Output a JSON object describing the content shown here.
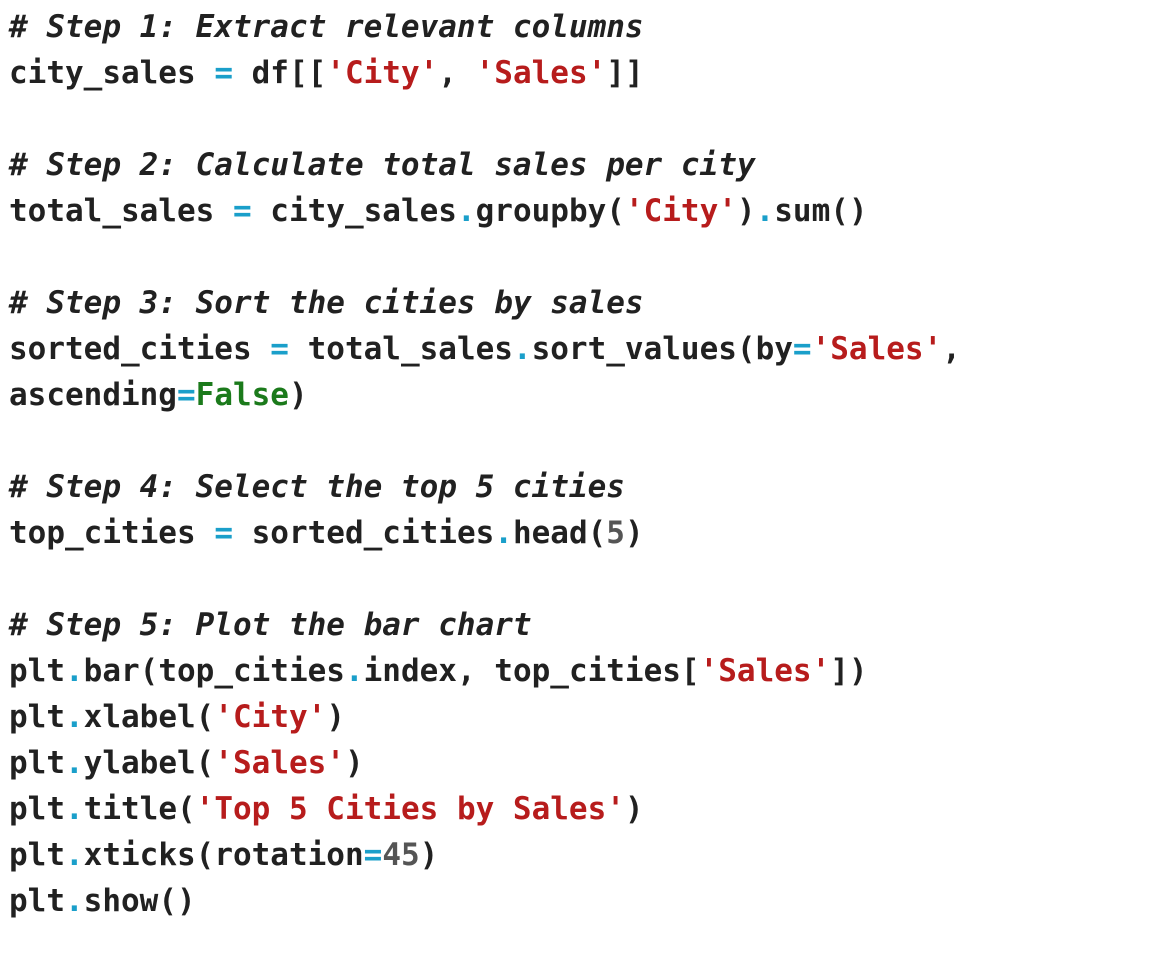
{
  "code": {
    "lines": [
      [
        {
          "t": "comment",
          "v": "# Step 1: Extract relevant columns"
        }
      ],
      [
        {
          "t": "text",
          "v": "city_sales "
        },
        {
          "t": "op",
          "v": "="
        },
        {
          "t": "text",
          "v": " df[["
        },
        {
          "t": "str",
          "v": "'City'"
        },
        {
          "t": "text",
          "v": ", "
        },
        {
          "t": "str",
          "v": "'Sales'"
        },
        {
          "t": "text",
          "v": "]]"
        }
      ],
      [],
      [
        {
          "t": "comment",
          "v": "# Step 2: Calculate total sales per city"
        }
      ],
      [
        {
          "t": "text",
          "v": "total_sales "
        },
        {
          "t": "op",
          "v": "="
        },
        {
          "t": "text",
          "v": " city_sales"
        },
        {
          "t": "op",
          "v": "."
        },
        {
          "t": "text",
          "v": "groupby("
        },
        {
          "t": "str",
          "v": "'City'"
        },
        {
          "t": "text",
          "v": ")"
        },
        {
          "t": "op",
          "v": "."
        },
        {
          "t": "text",
          "v": "sum()"
        }
      ],
      [],
      [
        {
          "t": "comment",
          "v": "# Step 3: Sort the cities by sales"
        }
      ],
      [
        {
          "t": "text",
          "v": "sorted_cities "
        },
        {
          "t": "op",
          "v": "="
        },
        {
          "t": "text",
          "v": " total_sales"
        },
        {
          "t": "op",
          "v": "."
        },
        {
          "t": "text",
          "v": "sort_values(by"
        },
        {
          "t": "op",
          "v": "="
        },
        {
          "t": "str",
          "v": "'Sales'"
        },
        {
          "t": "text",
          "v": ","
        }
      ],
      [
        {
          "t": "text",
          "v": "ascending"
        },
        {
          "t": "op",
          "v": "="
        },
        {
          "t": "kw",
          "v": "False"
        },
        {
          "t": "text",
          "v": ")"
        }
      ],
      [],
      [
        {
          "t": "comment",
          "v": "# Step 4: Select the top 5 cities"
        }
      ],
      [
        {
          "t": "text",
          "v": "top_cities "
        },
        {
          "t": "op",
          "v": "="
        },
        {
          "t": "text",
          "v": " sorted_cities"
        },
        {
          "t": "op",
          "v": "."
        },
        {
          "t": "text",
          "v": "head("
        },
        {
          "t": "num",
          "v": "5"
        },
        {
          "t": "text",
          "v": ")"
        }
      ],
      [],
      [
        {
          "t": "comment",
          "v": "# Step 5: Plot the bar chart"
        }
      ],
      [
        {
          "t": "text",
          "v": "plt"
        },
        {
          "t": "op",
          "v": "."
        },
        {
          "t": "text",
          "v": "bar(top_cities"
        },
        {
          "t": "op",
          "v": "."
        },
        {
          "t": "text",
          "v": "index, top_cities["
        },
        {
          "t": "str",
          "v": "'Sales'"
        },
        {
          "t": "text",
          "v": "])"
        }
      ],
      [
        {
          "t": "text",
          "v": "plt"
        },
        {
          "t": "op",
          "v": "."
        },
        {
          "t": "text",
          "v": "xlabel("
        },
        {
          "t": "str",
          "v": "'City'"
        },
        {
          "t": "text",
          "v": ")"
        }
      ],
      [
        {
          "t": "text",
          "v": "plt"
        },
        {
          "t": "op",
          "v": "."
        },
        {
          "t": "text",
          "v": "ylabel("
        },
        {
          "t": "str",
          "v": "'Sales'"
        },
        {
          "t": "text",
          "v": ")"
        }
      ],
      [
        {
          "t": "text",
          "v": "plt"
        },
        {
          "t": "op",
          "v": "."
        },
        {
          "t": "text",
          "v": "title("
        },
        {
          "t": "str",
          "v": "'Top 5 Cities by Sales'"
        },
        {
          "t": "text",
          "v": ")"
        }
      ],
      [
        {
          "t": "text",
          "v": "plt"
        },
        {
          "t": "op",
          "v": "."
        },
        {
          "t": "text",
          "v": "xticks(rotation"
        },
        {
          "t": "op",
          "v": "="
        },
        {
          "t": "num",
          "v": "45"
        },
        {
          "t": "text",
          "v": ")"
        }
      ],
      [
        {
          "t": "text",
          "v": "plt"
        },
        {
          "t": "op",
          "v": "."
        },
        {
          "t": "text",
          "v": "show()"
        }
      ]
    ]
  },
  "colors": {
    "text": "#212121",
    "operator": "#1a9fca",
    "string": "#b71c1c",
    "keyword": "#1b7a1b",
    "number": "#555555",
    "background": "#ffffff"
  }
}
